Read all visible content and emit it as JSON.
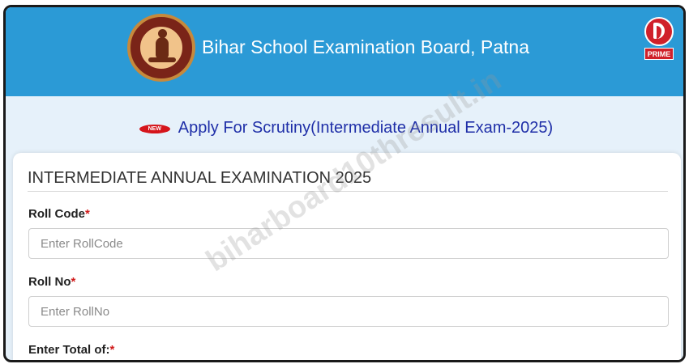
{
  "header": {
    "title": "Bihar School Examination Board, Patna",
    "logo_icon": "bseb-emblem-icon",
    "prime_badge": {
      "icon": "prime-logo-icon",
      "label": "PRIME"
    }
  },
  "notice": {
    "badge_icon": "new-badge-icon",
    "badge_text": "NEW",
    "link_text": "Apply For Scrutiny(Intermediate Annual Exam-2025)"
  },
  "form": {
    "title": "INTERMEDIATE ANNUAL EXAMINATION 2025",
    "roll_code": {
      "label": "Roll Code",
      "required_mark": "*",
      "placeholder": "Enter RollCode",
      "value": ""
    },
    "roll_no": {
      "label": "Roll No",
      "required_mark": "*",
      "placeholder": "Enter RollNo",
      "value": ""
    },
    "total_of": {
      "label": "Enter Total of:",
      "required_mark": "*"
    }
  },
  "watermark": "biharboard10thresult.in",
  "colors": {
    "header_bg": "#2b9ad6",
    "page_bg": "#e6f1fa",
    "link": "#1f2fa8",
    "required": "#d01a1a",
    "badge_red": "#d0202a"
  }
}
